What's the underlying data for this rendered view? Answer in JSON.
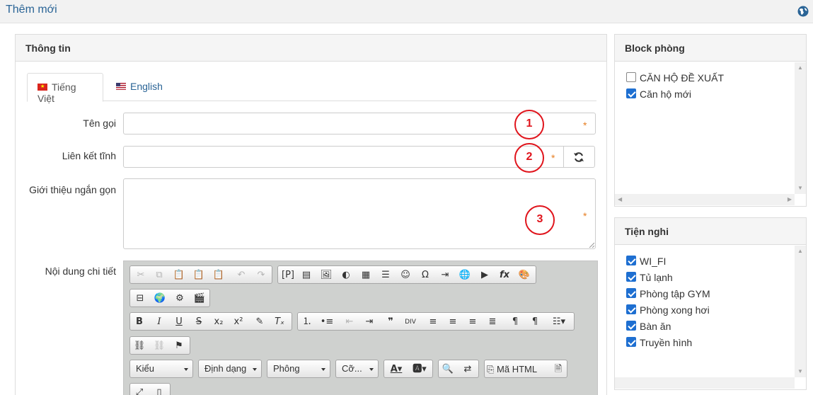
{
  "page": {
    "title": "Thêm mới",
    "help_icon": "globe-icon"
  },
  "info_panel": {
    "title": "Thông tin",
    "tabs": [
      {
        "label": "Tiếng Việt",
        "flag": "vn-flag-icon",
        "active": true
      },
      {
        "label": "English",
        "flag": "us-flag-icon",
        "active": false
      }
    ],
    "fields": {
      "name": {
        "label": "Tên gọi",
        "value": "",
        "required": "*",
        "marker": "1"
      },
      "static_link": {
        "label": "Liên kết tĩnh",
        "value": "",
        "required": "*",
        "marker": "2",
        "button_icon": "refresh-icon"
      },
      "short_intro": {
        "label": "Giới thiệu ngắn gọn",
        "value": "",
        "required": "*",
        "marker": "3"
      },
      "content": {
        "label": "Nội dung chi tiết"
      }
    },
    "editor": {
      "combos": {
        "style": "Kiểu",
        "format": "Định dạng",
        "font": "Phông",
        "size": "Cỡ..."
      },
      "source_label": "Mã HTML"
    }
  },
  "block_panel": {
    "title": "Block phòng",
    "items": [
      {
        "label": "CĂN HỘ ĐỀ XUẤT",
        "checked": false
      },
      {
        "label": "Căn hộ mới",
        "checked": true
      }
    ]
  },
  "amenities_panel": {
    "title": "Tiện nghi",
    "items": [
      {
        "label": "WI_FI",
        "checked": true
      },
      {
        "label": "Tủ lạnh",
        "checked": true
      },
      {
        "label": "Phòng tập GYM",
        "checked": true
      },
      {
        "label": "Phòng xong hơi",
        "checked": true
      },
      {
        "label": "Bàn ăn",
        "checked": true
      },
      {
        "label": "Truyền hình",
        "checked": true
      }
    ]
  },
  "colors": {
    "accent": "#2a6496",
    "required": "#e67e22",
    "marker": "#e0141c",
    "checkbox": "#1e6fd1"
  }
}
